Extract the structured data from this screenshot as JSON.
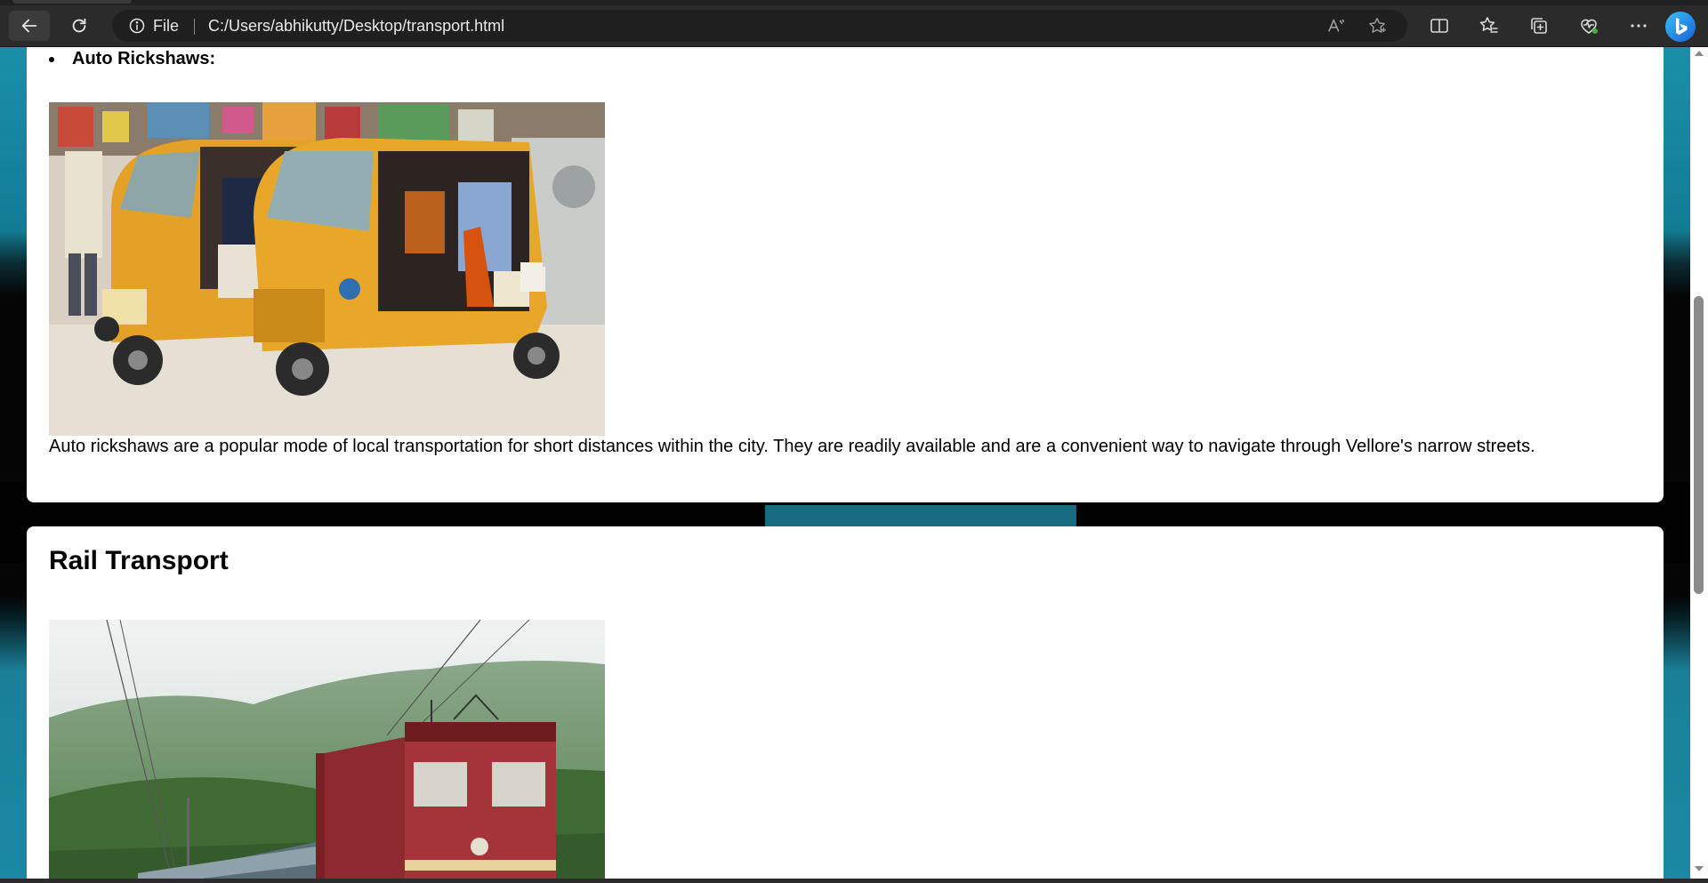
{
  "browser": {
    "site_info_label": "File",
    "url": "C:/Users/abhikutty/Desktop/transport.html",
    "icons": {
      "back": "back-arrow-icon",
      "reload": "reload-icon",
      "site_info": "info-icon",
      "read_aloud": "read-aloud-icon",
      "favorite": "star-icon",
      "split_screen": "split-screen-icon",
      "favorites": "favorites-icon",
      "collections": "collections-icon",
      "essentials": "browser-essentials-icon",
      "more": "more-icon",
      "copilot": "bing-icon"
    }
  },
  "page": {
    "auto_section": {
      "list_item": "Auto Rickshaws:",
      "description": "Auto rickshaws are a popular mode of local transportation for short distances within the city. They are readily available and are a convenient way to navigate through Vellore's narrow streets."
    },
    "rail_section": {
      "heading": "Rail Transport"
    }
  },
  "colors": {
    "chrome_bg": "#2b2b2b",
    "page_bg_teal": "#1a8fa8",
    "card_bg": "#ffffff"
  }
}
